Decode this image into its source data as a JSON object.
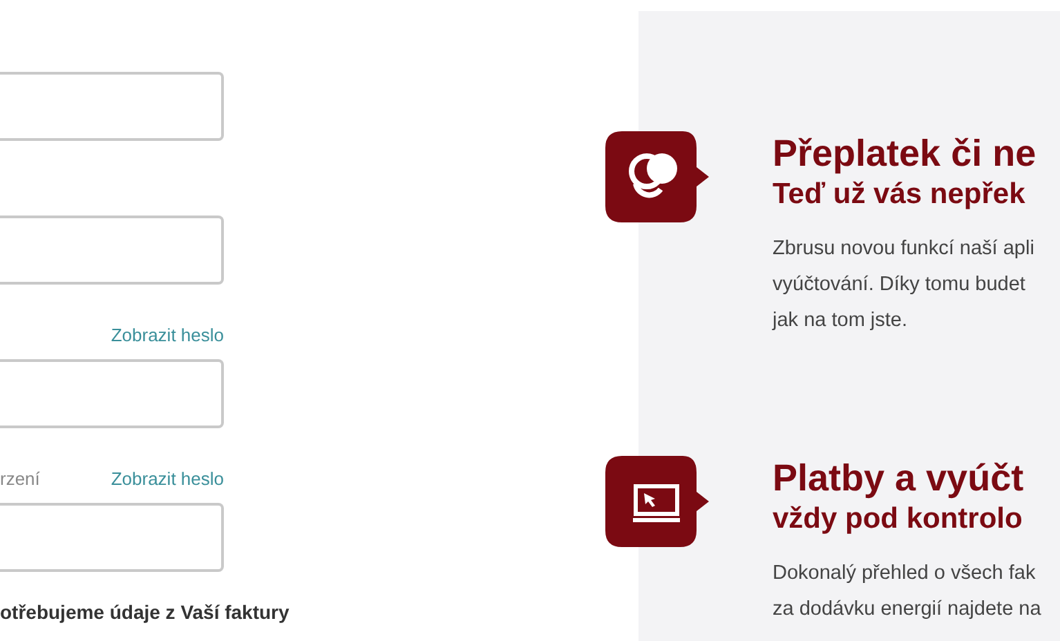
{
  "form": {
    "fields": [
      {
        "kind": "input"
      },
      {
        "kind": "input"
      },
      {
        "kind": "input",
        "link": "Zobrazit heslo"
      },
      {
        "kind": "input",
        "label": "rzení",
        "link": "Zobrazit heslo"
      }
    ],
    "note": "otřebujeme údaje z Vaší faktury"
  },
  "features": [
    {
      "kind": "coins",
      "title": "Přeplatek či ne",
      "subtitle": "Teď už vás nepřek",
      "lines": [
        "Zbrusu novou funkcí naší apli",
        "vyúčtování. Díky tomu budet",
        "jak na tom jste."
      ]
    },
    {
      "kind": "laptop",
      "title": "Platby a vyúčt",
      "subtitle": "vždy pod kontrolo",
      "lines": [
        "Dokonalý přehled o všech fak",
        "za dodávku energií najdete na"
      ]
    }
  ]
}
